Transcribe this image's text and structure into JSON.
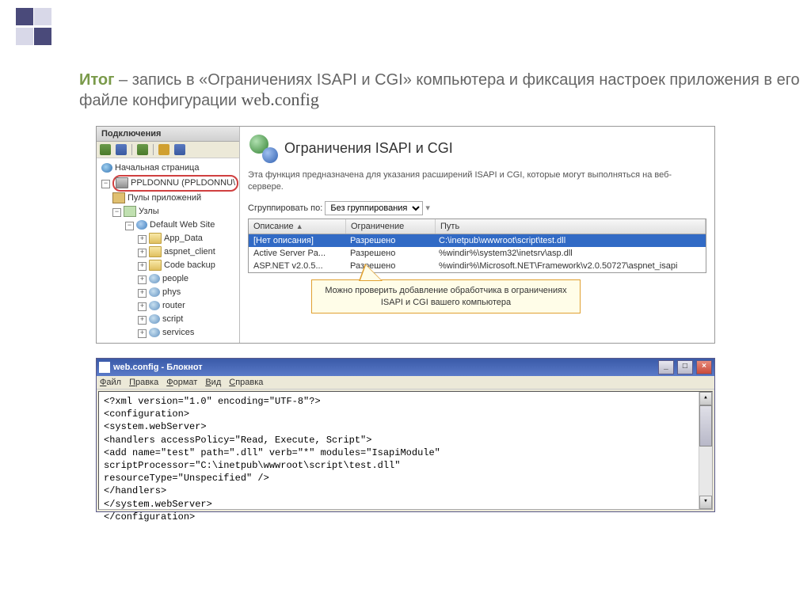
{
  "slide": {
    "title_bold": "Итог",
    "title_rest": " – запись в «Ограничениях ISAPI и CGI» компьютера и фиксация настроек приложения в его файле конфигурации ",
    "title_file": "web.config"
  },
  "sidebar": {
    "title": "Подключения",
    "tree": {
      "start": "Начальная страница",
      "server": "PPLDONNU (PPLDONNU\\",
      "pools": "Пулы приложений",
      "sites": "Узлы",
      "defaultSite": "Default Web Site",
      "folders": [
        "App_Data",
        "aspnet_client",
        "Code backup",
        "people",
        "phys",
        "router",
        "script",
        "services"
      ]
    }
  },
  "main": {
    "title": "Ограничения ISAPI и CGI",
    "description": "Эта функция предназначена для указания расширений ISAPI и CGI, которые могут выполняться на веб-сервере.",
    "groupby_label": "Сгруппировать по:",
    "groupby_value": "Без группирования",
    "columns": {
      "desc": "Описание",
      "restr": "Ограничение",
      "path": "Путь"
    },
    "rows": [
      {
        "desc": "[Нет описания]",
        "restr": "Разрешено",
        "path": "C:\\inetpub\\wwwroot\\script\\test.dll",
        "selected": true
      },
      {
        "desc": "Active Server Pa...",
        "restr": "Разрешено",
        "path": "%windir%\\system32\\inetsrv\\asp.dll",
        "selected": false
      },
      {
        "desc": "ASP.NET v2.0.5...",
        "restr": "Разрешено",
        "path": "%windir%\\Microsoft.NET\\Framework\\v2.0.50727\\aspnet_isapi",
        "selected": false
      }
    ],
    "callout": "Можно проверить добавление обработчика в ограничениях ISAPI и CGI вашего компьютера"
  },
  "notepad": {
    "title": "web.config - Блокнот",
    "menu": [
      "Файл",
      "Правка",
      "Формат",
      "Вид",
      "Справка"
    ],
    "lines": [
      "<?xml version=\"1.0\" encoding=\"UTF-8\"?>",
      "<configuration>",
      "    <system.webServer>",
      "        <handlers accessPolicy=\"Read, Execute, Script\">",
      "            <add name=\"test\" path=\".dll\" verb=\"*\" modules=\"IsapiModule\"",
      "              scriptProcessor=\"C:\\inetpub\\wwwroot\\script\\test.dll\"",
      "              resourceType=\"Unspecified\" />",
      "        </handlers>",
      "    </system.webServer>",
      "</configuration>"
    ]
  }
}
